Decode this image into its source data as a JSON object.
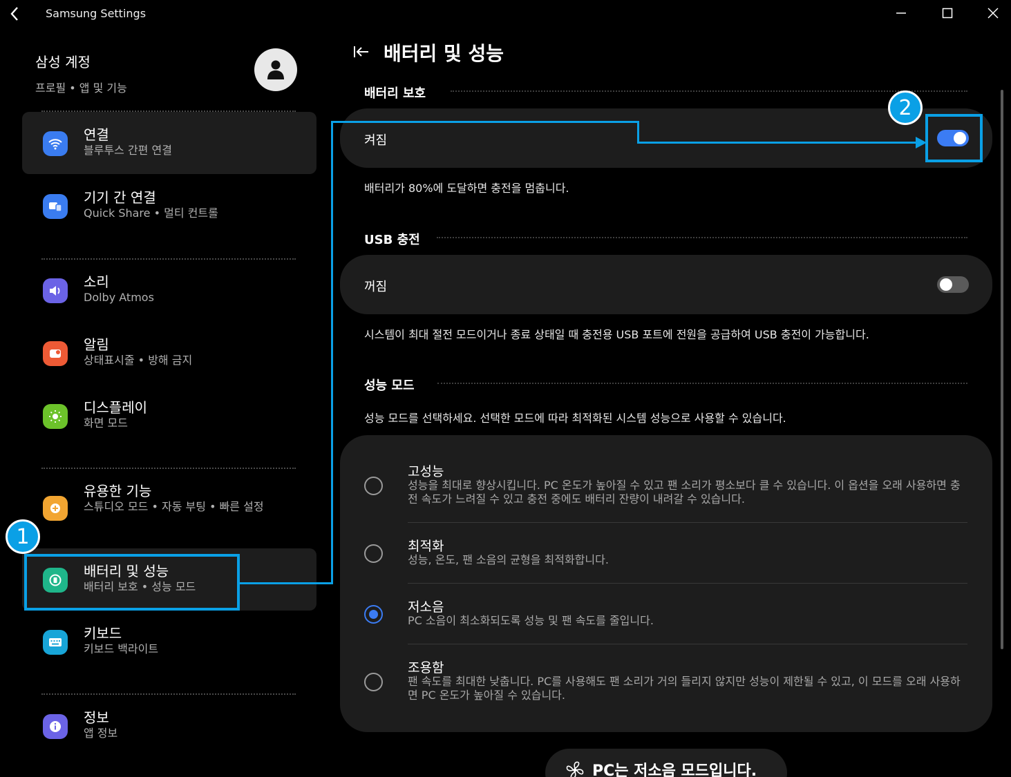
{
  "window": {
    "title": "Samsung Settings"
  },
  "account": {
    "name": "삼성 계정",
    "sub": "프로필 • 앱 및 기능"
  },
  "sidebar": {
    "items": [
      {
        "title": "연결",
        "sub": "블루투스 간편 연결"
      },
      {
        "title": "기기 간 연결",
        "sub": "Quick Share  •  멀티 컨트롤"
      },
      {
        "title": "소리",
        "sub": "Dolby Atmos"
      },
      {
        "title": "알림",
        "sub": "상태표시줄 • 방해 금지"
      },
      {
        "title": "디스플레이",
        "sub": "화면 모드"
      },
      {
        "title": "유용한 기능",
        "sub": "스튜디오 모드  •  자동 부팅  •  빠른 설정"
      },
      {
        "title": "배터리 및 성능",
        "sub": "배터리 보호  •  성능 모드"
      },
      {
        "title": "키보드",
        "sub": "키보드 백라이트"
      },
      {
        "title": "정보",
        "sub": "앱 정보"
      }
    ]
  },
  "main": {
    "title": "배터리 및 성능",
    "battery_protection": {
      "heading": "배터리 보호",
      "row_label": "켜짐",
      "toggle_on": true,
      "description": "배터리가 80%에 도달하면 충전을 멈춥니다."
    },
    "usb_charging": {
      "heading": "USB 충전",
      "row_label": "꺼짐",
      "toggle_on": false,
      "description": "시스템이 최대 절전 모드이거나 종료 상태일 때 충전용 USB 포트에 전원을 공급하여 USB 충전이 가능합니다."
    },
    "performance_mode": {
      "heading": "성능 모드",
      "description": "성능 모드를 선택하세요. 선택한 모드에 따라 최적화된 시스템 성능으로 사용할 수 있습니다.",
      "options": [
        {
          "title": "고성능",
          "desc": "성능을 최대로 향상시킵니다. PC 온도가 높아질 수 있고 팬 소리가 평소보다 클 수 있습니다. 이 옵션을 오래 사용하면 충전 속도가 느려질 수 있고 충전 중에도 배터리 잔량이 내려갈 수 있습니다.",
          "selected": false
        },
        {
          "title": "최적화",
          "desc": "성능, 온도, 팬 소음의 균형을 최적화합니다.",
          "selected": false
        },
        {
          "title": "저소음",
          "desc": "PC 소음이 최소화되도록 성능 및 팬 속도를 줄입니다.",
          "selected": true
        },
        {
          "title": "조용함",
          "desc": "팬 속도를 최대한 낮춥니다. PC를 사용해도 팬 소리가 거의 들리지 않지만 성능이 제한될 수 있고, 이 모드를 오래 사용하면 PC 온도가 높아질 수 있습니다.",
          "selected": false
        }
      ]
    },
    "status": "PC는 저소음 모드입니다."
  },
  "annotations": {
    "marker_1": "1",
    "marker_2": "2",
    "color": "#0aa0e6"
  },
  "colors": {
    "accent": "#3b7cf4",
    "card": "#1d1d1d"
  }
}
